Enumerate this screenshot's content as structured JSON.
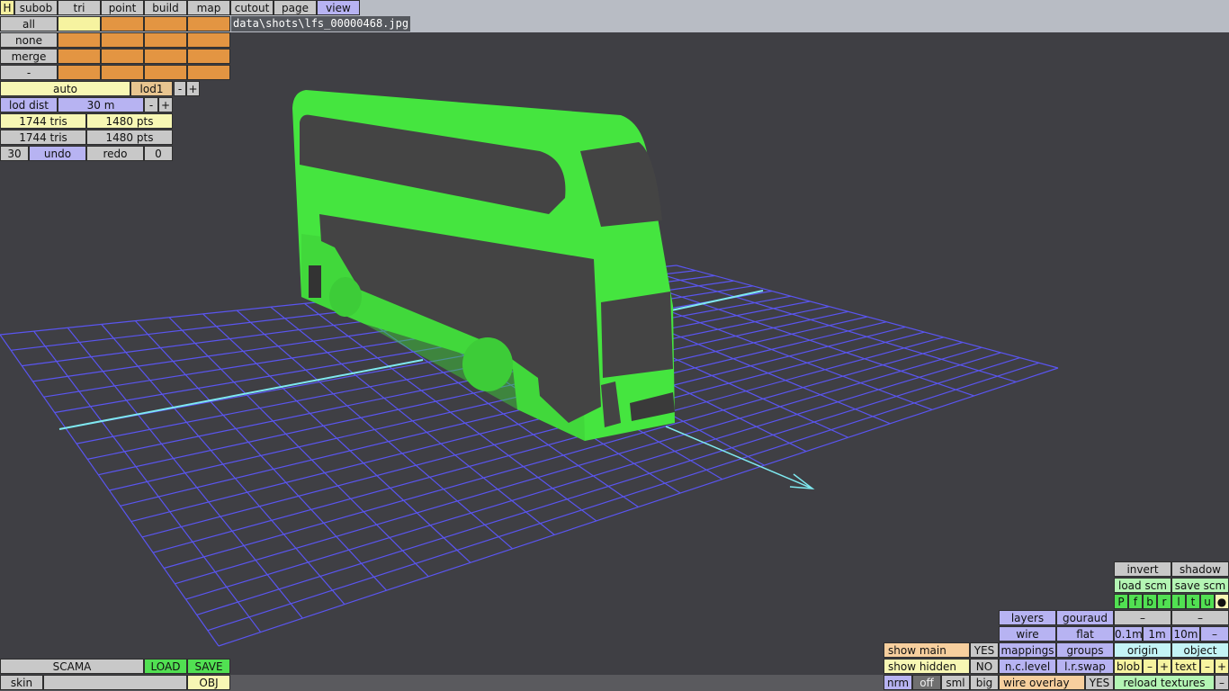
{
  "viewport": {
    "filename": "data\\shots\\lfs_00000468.jpg"
  },
  "top_tabs": [
    "H",
    "subob",
    "tri",
    "point",
    "build",
    "map",
    "cutout",
    "page",
    "view"
  ],
  "select_buttons": [
    "all",
    "none",
    "merge",
    "-"
  ],
  "lod": {
    "auto_label": "auto",
    "lod_label": "lod1",
    "minus": "-",
    "plus": "+",
    "dist_label": "lod dist",
    "dist_value": "30 m"
  },
  "stats": [
    {
      "tris": "1744 tris",
      "pts": "1480 pts"
    },
    {
      "tris": "1744 tris",
      "pts": "1480 pts"
    }
  ],
  "undo_row": {
    "count": "30",
    "undo": "undo",
    "redo": "redo",
    "redo_count": "0"
  },
  "bottom_left": {
    "scama": "SCAMA",
    "load": "LOAD",
    "save": "SAVE",
    "skin": "skin",
    "obj": "OBJ"
  },
  "right_panel": {
    "invert": "invert",
    "shadow": "shadow",
    "load_scm": "load scm",
    "save_scm": "save scm",
    "views": [
      "P",
      "f",
      "b",
      "r",
      "l",
      "t",
      "u",
      "●"
    ],
    "layers": "layers",
    "gouraud": "gouraud",
    "dash1": "–",
    "dash2": "–",
    "wire": "wire",
    "flat": "flat",
    "g01": "0.1m",
    "g1": "1m",
    "g10": "10m",
    "gminus": "–",
    "show_main": "show main",
    "show_main_val": "YES",
    "mappings": "mappings",
    "groups": "groups",
    "origin": "origin",
    "object": "object",
    "show_hidden": "show hidden",
    "show_hidden_val": "NO",
    "nclevel": "n.c.level",
    "lrswap": "l.r.swap",
    "blob": "blob",
    "blob_minus": "–",
    "blob_plus": "+",
    "text": "text",
    "text_minus": "–",
    "text_plus": "+",
    "nrm": "nrm",
    "off": "off",
    "sml": "sml",
    "big": "big",
    "wire_overlay": "wire overlay",
    "wire_overlay_val": "YES",
    "reload_textures": "reload textures",
    "reload_minus": "–"
  },
  "colors": {
    "bus": "#45e53f",
    "bus_window": "#444444",
    "grid": "#5a55f0",
    "axis": "#7fe9f0",
    "background": "#3f3f44"
  }
}
